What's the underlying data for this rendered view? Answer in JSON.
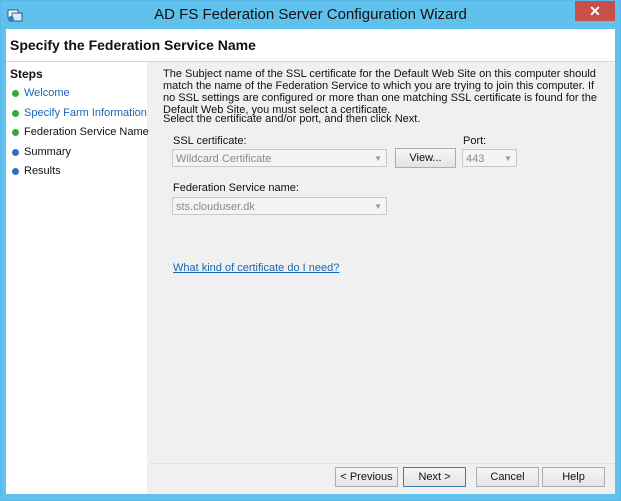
{
  "window": {
    "title": "AD FS Federation Server Configuration Wizard",
    "close_symbol": "✕"
  },
  "header": {
    "page_title": "Specify the Federation Service Name"
  },
  "steps": {
    "heading": "Steps",
    "items": [
      {
        "label": "Welcome",
        "status": "done"
      },
      {
        "label": "Specify Farm Information",
        "status": "done"
      },
      {
        "label": "Federation Service Name",
        "status": "current"
      },
      {
        "label": "Summary",
        "status": "pending"
      },
      {
        "label": "Results",
        "status": "pending"
      }
    ]
  },
  "content": {
    "description": "The Subject name of the SSL certificate for the Default Web Site on this computer should match the name of the Federation Service to which you are trying to join this computer. If no SSL settings are configured or more than one matching SSL certificate is found for the Default Web Site, you must select a certificate.",
    "instruction": "Select the certificate and/or port, and then click Next.",
    "ssl_label": "SSL certificate:",
    "ssl_value": "Wildcard Certificate",
    "view_button": "View...",
    "port_label": "Port:",
    "port_value": "443",
    "fs_name_label": "Federation Service name:",
    "fs_name_value": "sts.clouduser.dk",
    "help_link": "What kind of certificate do I need?"
  },
  "footer": {
    "previous": "< Previous",
    "next": "Next >",
    "cancel": "Cancel",
    "help": "Help"
  },
  "colors": {
    "titlebar": "#5fc1ec",
    "close": "#c7504a",
    "link": "#1767b6",
    "done_dot": "#3aa93a",
    "pending_dot": "#2f6fc9"
  }
}
